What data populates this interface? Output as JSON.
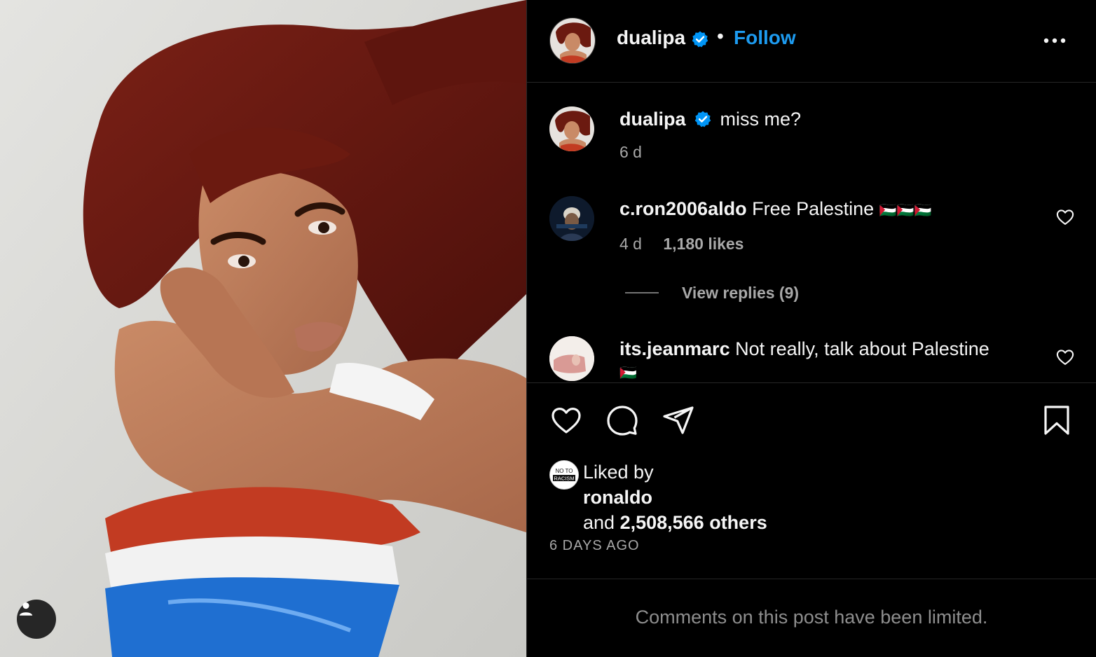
{
  "post": {
    "header": {
      "username": "dualipa",
      "separator": "•",
      "follow_label": "Follow"
    },
    "caption": {
      "username": "dualipa",
      "text": "miss me?",
      "time": "6 d"
    },
    "comments": [
      {
        "username": "c.ron2006aldo",
        "text": "Free Palestine",
        "flags": "🇵🇸🇵🇸🇵🇸",
        "time": "4 d",
        "likes": "1,180 likes",
        "view_replies": "View replies (9)"
      },
      {
        "username": "its.jeanmarc",
        "text": "Not really, talk about Palestine",
        "flags": "🇵🇸"
      }
    ],
    "liked_by": {
      "avatar_text_top": "NO TO",
      "avatar_text_bottom": "RACISM",
      "prefix": "Liked by",
      "user": "ronaldo",
      "and_label": "and",
      "others": "2,508,566 others"
    },
    "time_ago": "6 DAYS AGO",
    "comments_limited": "Comments on this post have been limited."
  },
  "colors": {
    "background": "#000000",
    "accent": "#1d9bf0",
    "verified": "#0095f6",
    "muted": "#a8a8a8",
    "hair": "#6b1a10"
  },
  "icons": {
    "header": [
      "verified-badge-icon",
      "more-options-icon"
    ],
    "actions": [
      "heart-icon",
      "comment-icon",
      "share-icon",
      "bookmark-icon"
    ],
    "photo": [
      "user-tag-icon"
    ]
  }
}
